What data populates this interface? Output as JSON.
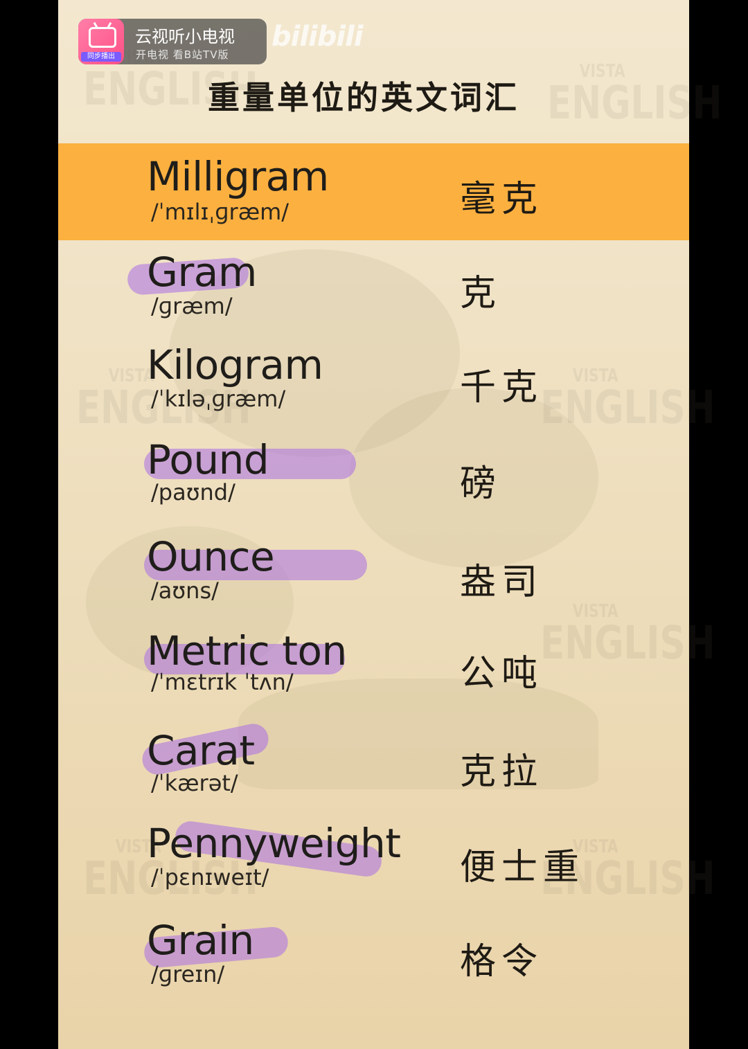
{
  "badge": {
    "title": "云视听小电视",
    "subtitle": "开电视 看B站TV版",
    "icon_tag": "同步播出",
    "icon": "tv-icon"
  },
  "watermark_logo": "bilibili",
  "watermarks": {
    "small": "VISTA",
    "big": "ENGLISH"
  },
  "title": "重量单位的英文词汇",
  "colors": {
    "background": "#efe0c1",
    "active_row": "#fbb040",
    "highlight": "#b57be6",
    "text": "#1f1d1a"
  },
  "rows": [
    {
      "word": "Milligram",
      "ipa": "/ˈmɪlɪˌɡræm/",
      "cn": "毫克",
      "active": true,
      "highlighted": false
    },
    {
      "word": "Gram",
      "ipa": "/ɡræm/",
      "cn": "克",
      "active": false,
      "highlighted": true
    },
    {
      "word": "Kilogram",
      "ipa": "/ˈkɪləˌɡræm/",
      "cn": "千克",
      "active": false,
      "highlighted": false
    },
    {
      "word": "Pound",
      "ipa": "/paʊnd/",
      "cn": "磅",
      "active": false,
      "highlighted": true
    },
    {
      "word": "Ounce",
      "ipa": "/aʊns/",
      "cn": "盎司",
      "active": false,
      "highlighted": true
    },
    {
      "word": "Metric ton",
      "ipa": "/ˈmɛtrɪk ˈtʌn/",
      "cn": "公吨",
      "active": false,
      "highlighted": true
    },
    {
      "word": "Carat",
      "ipa": "/ˈkærət/",
      "cn": "克拉",
      "active": false,
      "highlighted": true
    },
    {
      "word": "Pennyweight",
      "ipa": "/ˈpɛnɪweɪt/",
      "cn": "便士重",
      "active": false,
      "highlighted": true
    },
    {
      "word": "Grain",
      "ipa": "/ɡreɪn/",
      "cn": "格令",
      "active": false,
      "highlighted": true
    }
  ]
}
